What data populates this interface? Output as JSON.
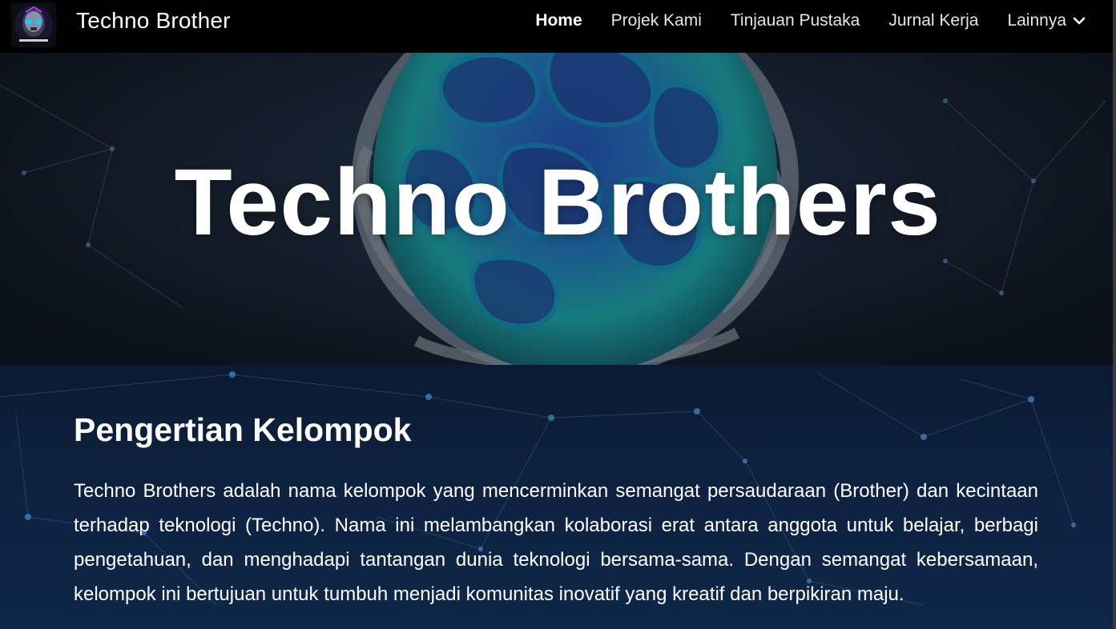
{
  "header": {
    "site_title": "Techno Brother",
    "logo_icon": "robot-logo-icon",
    "nav": [
      {
        "label": "Home",
        "active": true
      },
      {
        "label": "Projek Kami",
        "active": false
      },
      {
        "label": "Tinjauan Pustaka",
        "active": false
      },
      {
        "label": "Jurnal Kerja",
        "active": false
      },
      {
        "label": "Lainnya",
        "active": false,
        "has_dropdown": true
      }
    ]
  },
  "hero": {
    "title": "Techno Brothers"
  },
  "section": {
    "heading": "Pengertian Kelompok",
    "body": "Techno Brothers adalah nama kelompok yang mencerminkan semangat persaudaraan (Brother) dan kecintaan terhadap teknologi (Techno). Nama ini melambangkan kolaborasi erat antara anggota untuk belajar, berbagi pengetahuan, dan menghadapi tantangan dunia teknologi bersama-sama. Dengan semangat kebersamaan, kelompok ini bertujuan untuk tumbuh menjadi komunitas inovatif yang kreatif dan berpikiran maju."
  },
  "colors": {
    "topbar": "#000000",
    "content_bg": "#0e2240",
    "hero_glow": "#1f8f8a"
  }
}
